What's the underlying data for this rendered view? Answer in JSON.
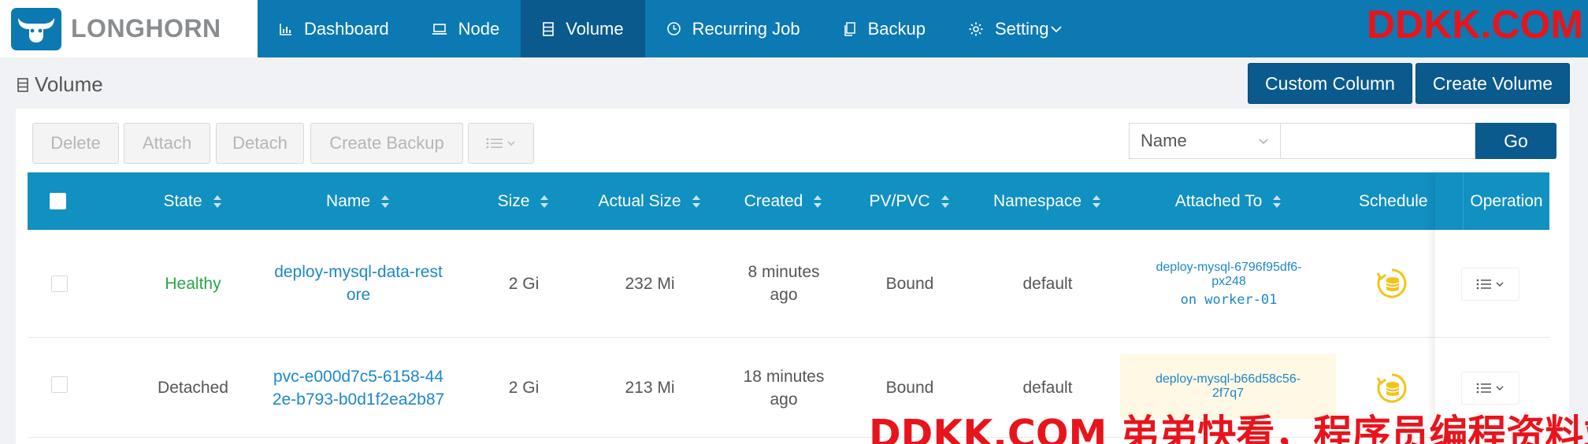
{
  "brand": {
    "logo_text": "LONGHORN",
    "primary": "#0c79b2",
    "active": "#0a5a8d",
    "header": "#1190c2"
  },
  "nav": {
    "items": [
      {
        "label": "Dashboard",
        "icon": "dashboard-chart-icon",
        "active": false
      },
      {
        "label": "Node",
        "icon": "node-laptop-icon",
        "active": false
      },
      {
        "label": "Volume",
        "icon": "volume-database-icon",
        "active": true
      },
      {
        "label": "Recurring Job",
        "icon": "recurring-clock-icon",
        "active": false
      },
      {
        "label": "Backup",
        "icon": "backup-copy-icon",
        "active": false
      },
      {
        "label": "Setting",
        "icon": "gear-icon",
        "active": false
      }
    ]
  },
  "watermarks": {
    "top": "DDKK.COM",
    "bottom": "DDKK.COM 弟弟快看，程序员编程资料站"
  },
  "page": {
    "title": "Volume",
    "custom_column_label": "Custom Column",
    "create_volume_label": "Create Volume"
  },
  "toolbar": {
    "delete_label": "Delete",
    "attach_label": "Attach",
    "detach_label": "Detach",
    "create_backup_label": "Create Backup"
  },
  "search": {
    "field_selected": "Name",
    "value": "",
    "go_label": "Go"
  },
  "table": {
    "headers": {
      "state": "State",
      "name": "Name",
      "size": "Size",
      "actual_size": "Actual Size",
      "created": "Created",
      "pvpvc": "PV/PVC",
      "namespace": "Namespace",
      "attached_to": "Attached To",
      "schedule": "Schedule",
      "operation": "Operation"
    },
    "rows": [
      {
        "state": "Healthy",
        "name_line1": "deploy-mysql-data-rest",
        "name_line2": "ore",
        "size": "2 Gi",
        "actual_size": "232 Mi",
        "created_line1": "8 minutes",
        "created_line2": "ago",
        "pvpvc": "Bound",
        "namespace": "default",
        "attached_line1": "deploy-mysql-6796f95df6-",
        "attached_line2": "px248",
        "attached_node": "on worker-01"
      },
      {
        "state": "Detached",
        "name_line1": "pvc-e000d7c5-6158-44",
        "name_line2": "2e-b793-b0d1f2ea2b87",
        "size": "2 Gi",
        "actual_size": "213 Mi",
        "created_line1": "18 minutes",
        "created_line2": "ago",
        "pvpvc": "Bound",
        "namespace": "default",
        "attached_line1": "deploy-mysql-b66d58c56-",
        "attached_line2": "2f7q7",
        "attached_node": ""
      }
    ]
  }
}
